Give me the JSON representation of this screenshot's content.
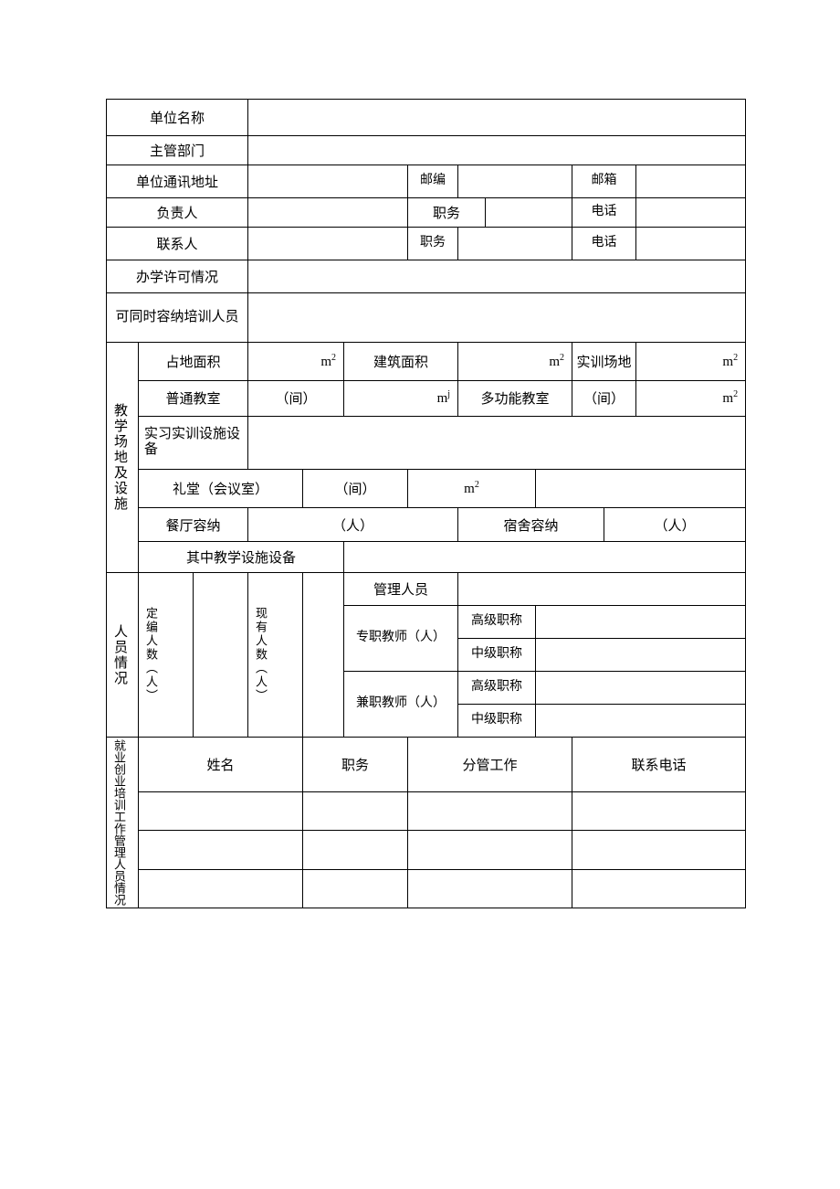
{
  "labels": {
    "unit_name": "单位名称",
    "dept": "主管部门",
    "address": "单位通讯地址",
    "postcode": "邮编",
    "email": "邮箱",
    "leader": "负责人",
    "position": "职务",
    "phone": "电话",
    "contact": "联系人",
    "license": "办学许可情况",
    "capacity": "可同时容纳培训人员",
    "facility": "教学场地及设施",
    "land_area": "占地面积",
    "build_area": "建筑面积",
    "training_site": "实训场地",
    "classroom": "普通教室",
    "multi_room": "多功能教室",
    "equip": "实习实训设施设备",
    "hall": "礼堂（会议室）",
    "canteen": "餐厅容纳",
    "dorm": "宿舍容纳",
    "teach_equip": "其中教学设施设备",
    "staff": "人员情况",
    "quota": "定编人数（人）",
    "current": "现有人数（人）",
    "mgmt": "管理人员",
    "ft_teacher": "专职教师（人）",
    "pt_teacher": "兼职教师（人）",
    "senior": "高级职称",
    "mid": "中级职称",
    "mgmt_section": "就业创业培训工作管理人员情况",
    "name": "姓名",
    "duty": "职务",
    "work": "分管工作",
    "tel": "联系电话"
  },
  "units": {
    "m2": "m",
    "sup2": "2",
    "supj": "j",
    "room": "（间）",
    "person": "（人）"
  }
}
